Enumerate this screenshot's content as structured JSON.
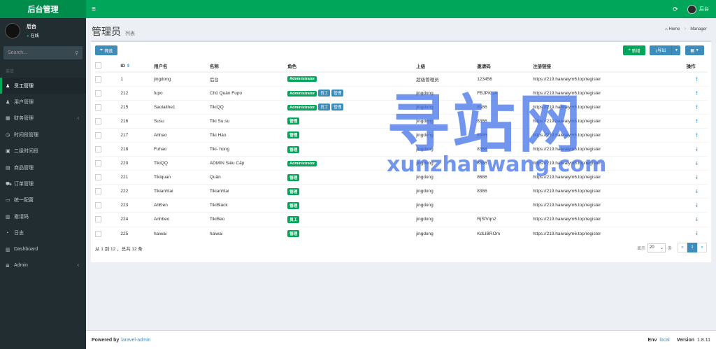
{
  "app": {
    "logo": "后台管理"
  },
  "topbar": {
    "menu_icon": "≡",
    "refresh_icon": "⟳",
    "user_name": "后台"
  },
  "sidebar": {
    "user": {
      "name": "后台",
      "status": "在线"
    },
    "search": {
      "placeholder": "Search..."
    },
    "nav_header": "菜单",
    "items": [
      {
        "label": "员工管理",
        "icon": "user-icon",
        "glyph": "♟",
        "active": true
      },
      {
        "label": "用户管理",
        "icon": "users-icon",
        "glyph": "♟"
      },
      {
        "label": "财务管理",
        "icon": "bank-icon",
        "glyph": "▦",
        "has_children": true
      },
      {
        "label": "时间段管理",
        "icon": "clock-icon",
        "glyph": "◷"
      },
      {
        "label": "二级时间段",
        "icon": "calendar-icon",
        "glyph": "▣"
      },
      {
        "label": "商品管理",
        "icon": "product-icon",
        "glyph": "▤"
      },
      {
        "label": "订单管理",
        "icon": "cart-icon",
        "glyph": "⛟"
      },
      {
        "label": "统一配置",
        "icon": "monitor-icon",
        "glyph": "▭"
      },
      {
        "label": "邀请码",
        "icon": "book-icon",
        "glyph": "▥"
      },
      {
        "label": "日志",
        "icon": "history-icon",
        "glyph": "◔"
      },
      {
        "label": "Dashboard",
        "icon": "dashboard-icon",
        "glyph": "▥"
      },
      {
        "label": "Admin",
        "icon": "tasks-icon",
        "glyph": "≣",
        "has_children": true
      }
    ]
  },
  "page": {
    "title": "管理员",
    "subtitle": "列表",
    "breadcrumb": [
      "Home",
      "Manager"
    ]
  },
  "toolbar": {
    "filter": "筛选",
    "new": "新增",
    "export": "导出"
  },
  "table": {
    "headers": [
      "ID",
      "用户名",
      "名称",
      "角色",
      "上级",
      "邀请码",
      "注册链接",
      "操作"
    ],
    "rows": [
      {
        "id": "1",
        "username": "jingdong",
        "name": "后台",
        "roles": [
          "Administrator"
        ],
        "parent": "超级管理员",
        "invite": "123456",
        "link": "https://219.haiwaiym6.top/register"
      },
      {
        "id": "212",
        "username": "fupo",
        "name": "Chủ Quản Fupo",
        "roles": [
          "Administrator",
          "员工",
          "管理"
        ],
        "parent": "jingdong",
        "invite": "FBJPKUA",
        "link": "https://219.haiwaiym6.top/register"
      },
      {
        "id": "215",
        "username": "Saolaithe1",
        "name": "TikiQQ",
        "roles": [
          "Administrator",
          "员工",
          "管理"
        ],
        "parent": "jingdong",
        "invite": "8386",
        "link": "https://219.haiwaiym6.top/register"
      },
      {
        "id": "216",
        "username": "Susu",
        "name": "Tiki Su.su",
        "roles": [
          "管理"
        ],
        "parent": "jingdong",
        "invite": "8386",
        "link": "https://219.haiwaiym6.top/register"
      },
      {
        "id": "217",
        "username": "Ahhao",
        "name": "Tiki Hào",
        "roles": [
          "管理"
        ],
        "parent": "jingdong",
        "invite": "8386",
        "link": "https://219.haiwaiym6.top/register"
      },
      {
        "id": "218",
        "username": "Fuhao",
        "name": "Tiki- hùng",
        "roles": [
          "管理"
        ],
        "parent": "jingdong",
        "invite": "8386",
        "link": "https://219.haiwaiym6.top/register"
      },
      {
        "id": "220",
        "username": "TikiQQ",
        "name": "ADMIN Siêu Cấp",
        "roles": [
          "Administrator"
        ],
        "parent": "jingdong",
        "invite": "8386",
        "link": "https://219.haiwaiym6.top/register"
      },
      {
        "id": "221",
        "username": "Tikiquan",
        "name": "Quân",
        "roles": [
          "管理"
        ],
        "parent": "jingdong",
        "invite": "8686",
        "link": "https://219.haiwaiym6.top/register"
      },
      {
        "id": "222",
        "username": "Tikianhtai",
        "name": "Tikianhtai",
        "roles": [
          "管理"
        ],
        "parent": "jingdong",
        "invite": "8386",
        "link": "https://219.haiwaiym6.top/register"
      },
      {
        "id": "223",
        "username": "AhĐen",
        "name": "TikiBlack",
        "roles": [
          "管理"
        ],
        "parent": "jingdong",
        "invite": "",
        "link": "https://219.haiwaiym6.top/register"
      },
      {
        "id": "224",
        "username": "Anhbeo",
        "name": "TikiBeo",
        "roles": [
          "员工"
        ],
        "parent": "jingdong",
        "invite": "RjSfVqn2",
        "link": "https://219.haiwaiym6.top/register"
      },
      {
        "id": "225",
        "username": "haiwai",
        "name": "haiwai",
        "roles": [
          "管理"
        ],
        "parent": "jingdong",
        "invite": "KdLIBROm",
        "link": "https://219.haiwaiym6.top/register"
      }
    ]
  },
  "pagination": {
    "summary": "从 1 到 12 ，总共 12 条",
    "show_label": "显示",
    "per_page": "20",
    "per_page_unit": "条",
    "prev": "«",
    "current": "1",
    "next": "»"
  },
  "watermark": {
    "line1": "寻站网",
    "line2": "xunzhanwang.com"
  },
  "footer": {
    "powered_by": "Powered by",
    "link": "laravel-admin",
    "env_label": "Env",
    "env_value": "local",
    "version_label": "Version",
    "version_value": "1.8.11"
  },
  "colors": {
    "header": "#00a65a",
    "logo_bg": "#008d4c",
    "sidebar": "#222d32",
    "primary": "#3c8dbc",
    "success": "#00a65a"
  }
}
